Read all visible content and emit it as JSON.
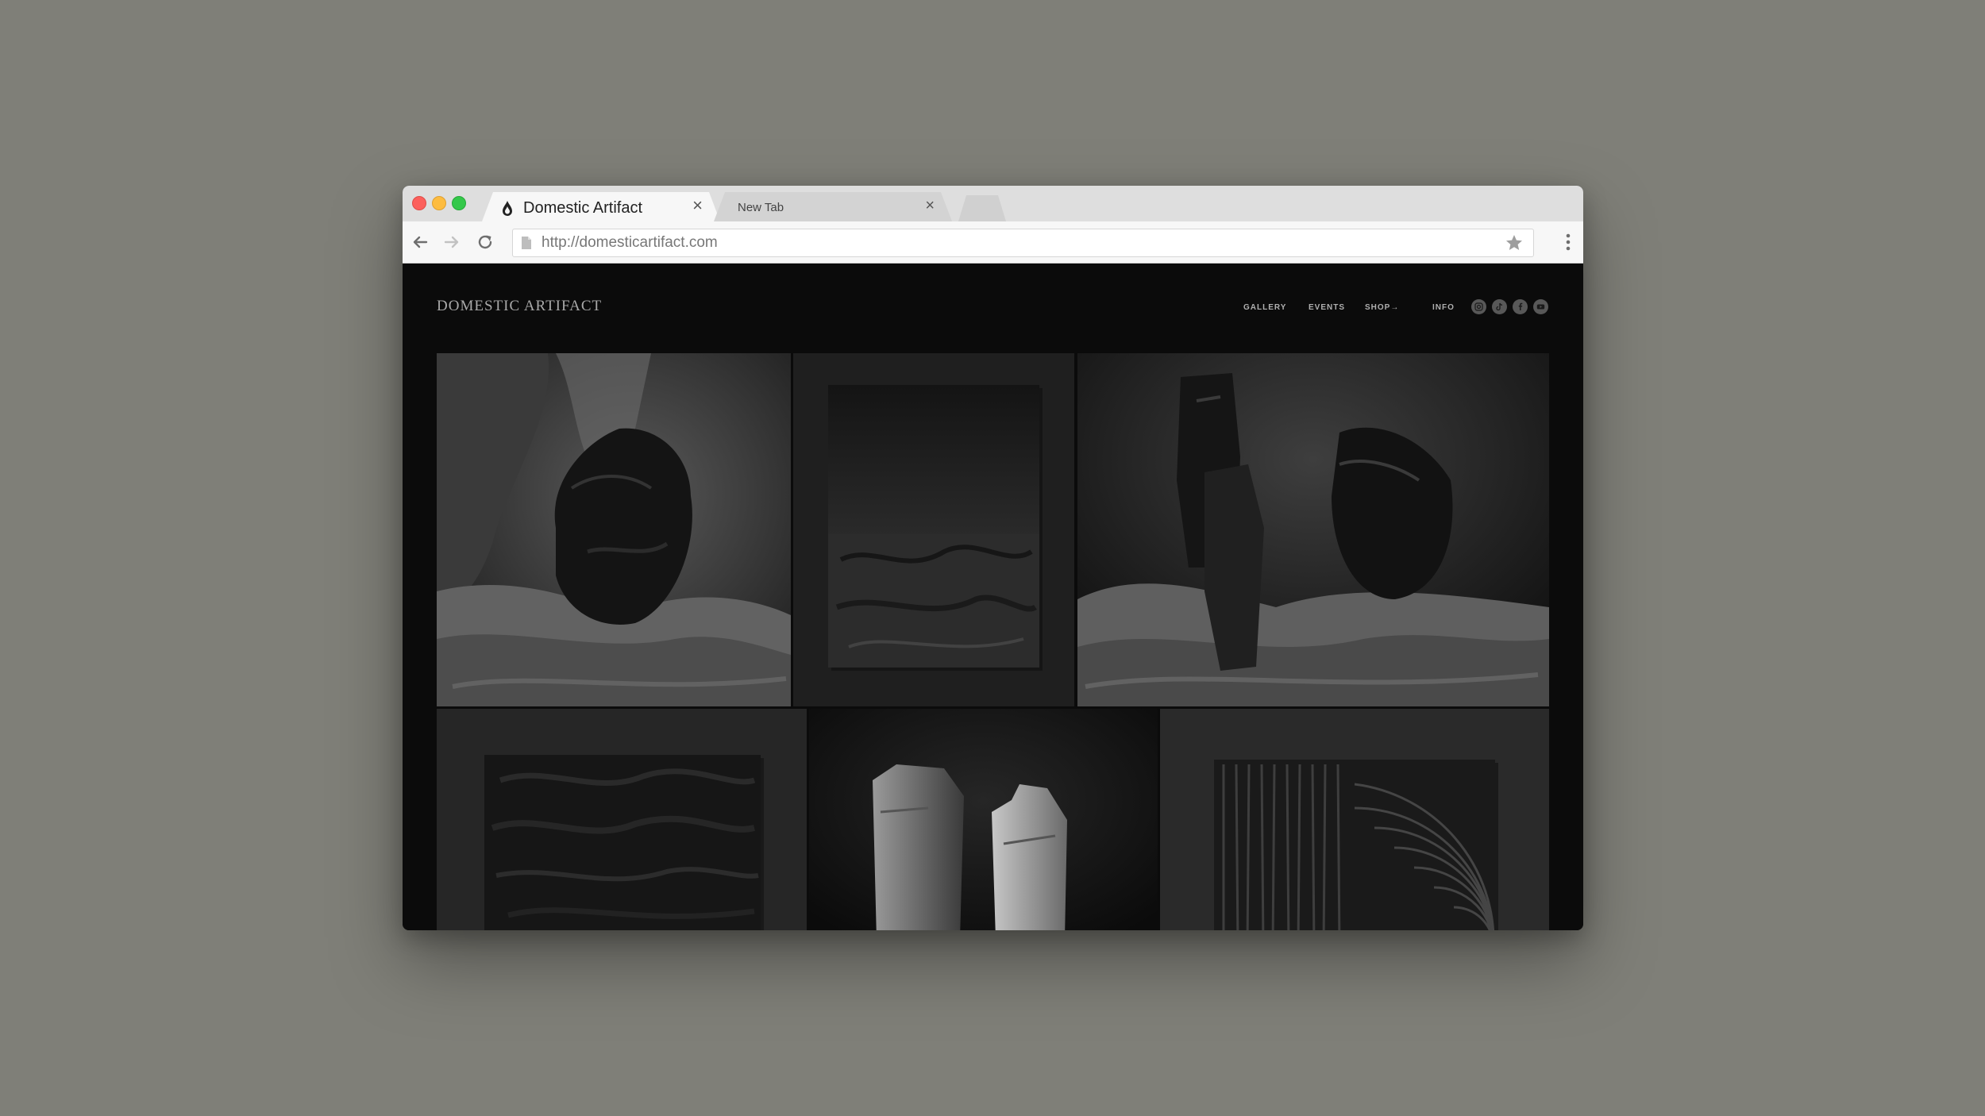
{
  "browser": {
    "tabs": [
      {
        "title": "Domestic Artifact",
        "active": true
      },
      {
        "title": "New Tab",
        "active": false
      }
    ],
    "url": "http://domesticartifact.com",
    "icons": [
      "back-icon",
      "forward-icon",
      "reload-icon",
      "page-icon",
      "star-icon",
      "menu-icon"
    ]
  },
  "site": {
    "logo": "DOMESTIC ARTIFACT",
    "nav": [
      "GALLERY",
      "EVENTS",
      "SHOP→",
      "INFO"
    ],
    "social_icons": [
      "instagram-icon",
      "tiktok-icon",
      "facebook-icon",
      "youtube-icon"
    ]
  },
  "gallery": {
    "images": [
      "rock-on-draped-fabric",
      "framed-textured-panel",
      "three-rocks-on-fabric",
      "textured-canvas-panel",
      "two-stone-pillars",
      "grooved-relief-panel"
    ]
  },
  "colors": {
    "background": "#7f7f78",
    "site_background": "#0b0b0b",
    "nav_text": "#b0b0b0"
  }
}
